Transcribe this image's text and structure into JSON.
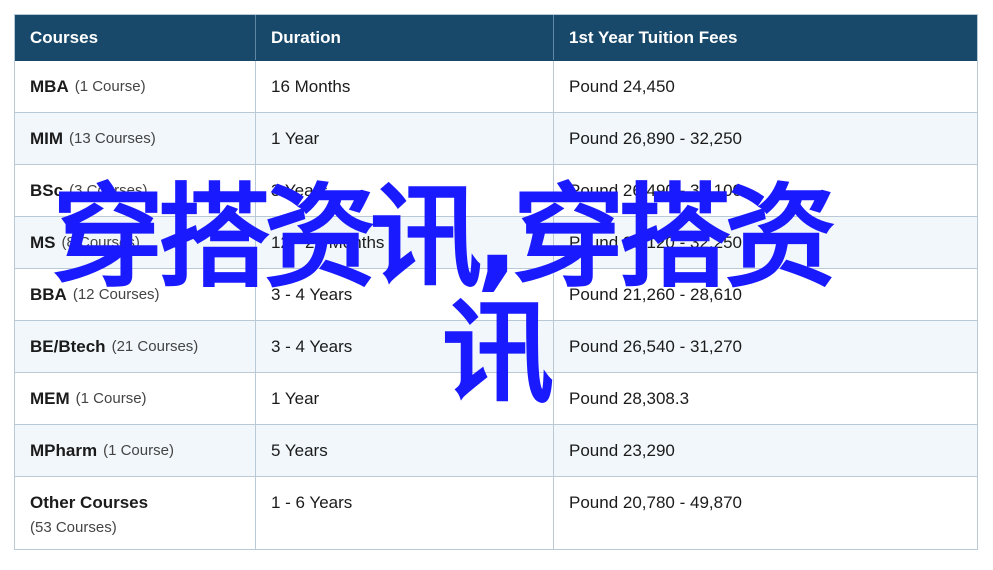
{
  "table": {
    "headers": [
      "Courses",
      "Duration",
      "1st Year Tuition Fees"
    ],
    "rows": [
      {
        "name": "MBA",
        "count": "(1 Course)",
        "duration": "16 Months",
        "fee": "Pound 24,450"
      },
      {
        "name": "MIM",
        "count": "(13 Courses)",
        "duration": "1 Year",
        "fee": "Pound 26,890 - 32,250"
      },
      {
        "name": "BSc",
        "count": "(3 Courses)",
        "duration": "3 Years",
        "fee": "Pound 26,490 - 30,100"
      },
      {
        "name": "MS",
        "count": "(8 Courses)",
        "duration": "12 - 20 Months",
        "fee": "Pound 20,120 - 32,250"
      },
      {
        "name": "BBA",
        "count": "(12 Courses)",
        "duration": "3 - 4 Years",
        "fee": "Pound 21,260 - 28,610"
      },
      {
        "name": "BE/Btech",
        "count": "(21 Courses)",
        "duration": "3 - 4 Years",
        "fee": "Pound 26,540 - 31,270"
      },
      {
        "name": "MEM",
        "count": "(1 Course)",
        "duration": "1 Year",
        "fee": "Pound 28,308.3"
      },
      {
        "name": "MPharm",
        "count": "(1 Course)",
        "duration": "5 Years",
        "fee": "Pound 23,290"
      },
      {
        "name": "Other Courses",
        "count": "(53 Courses)",
        "duration": "1 - 6 Years",
        "fee": "Pound 20,780 - 49,870"
      }
    ]
  },
  "watermark": {
    "line1": "穿搭资讯,穿搭资",
    "line2": "讯",
    "color": "#1a1aff"
  },
  "colors": {
    "header_bg": "#19496a",
    "row_alt_bg": "#f2f7fb",
    "border": "#b9cad6"
  }
}
